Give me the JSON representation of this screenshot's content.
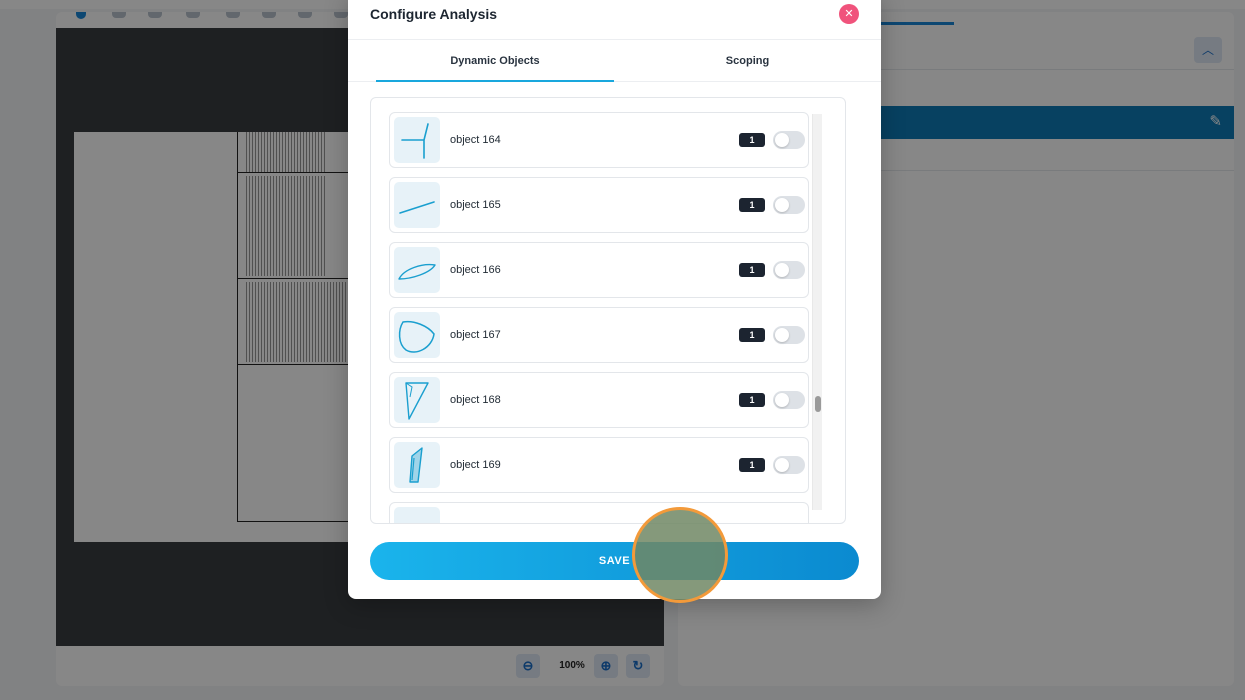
{
  "background": {
    "zoom_level": "100%",
    "icons": {
      "zoom_out": "zoom-out-icon",
      "zoom_in": "zoom-in-icon",
      "reset": "refresh-icon",
      "collapse": "chevron-up-icon",
      "edit": "pencil-icon"
    },
    "accent_color": "#1a87d8"
  },
  "modal": {
    "title": "Configure Analysis",
    "close_icon": "close-icon",
    "tabs": [
      {
        "label": "Dynamic Objects",
        "active": true
      },
      {
        "label": "Scoping",
        "active": false
      }
    ],
    "objects": [
      {
        "name": "object 164",
        "count": "1",
        "enabled": false,
        "icon": "shape-object-164-icon"
      },
      {
        "name": "object 165",
        "count": "1",
        "enabled": false,
        "icon": "shape-object-165-icon"
      },
      {
        "name": "object 166",
        "count": "1",
        "enabled": false,
        "icon": "shape-object-166-icon"
      },
      {
        "name": "object 167",
        "count": "1",
        "enabled": false,
        "icon": "shape-object-167-icon"
      },
      {
        "name": "object 168",
        "count": "1",
        "enabled": false,
        "icon": "shape-object-168-icon"
      },
      {
        "name": "object 169",
        "count": "1",
        "enabled": false,
        "icon": "shape-object-169-icon"
      }
    ],
    "save_label": "SAVE",
    "colors": {
      "tab_accent": "#19a7dd",
      "close": "#f0537c",
      "save_start": "#1ab4ec",
      "save_end": "#0b8ad0",
      "shape_stroke": "#1a9fcf"
    }
  }
}
